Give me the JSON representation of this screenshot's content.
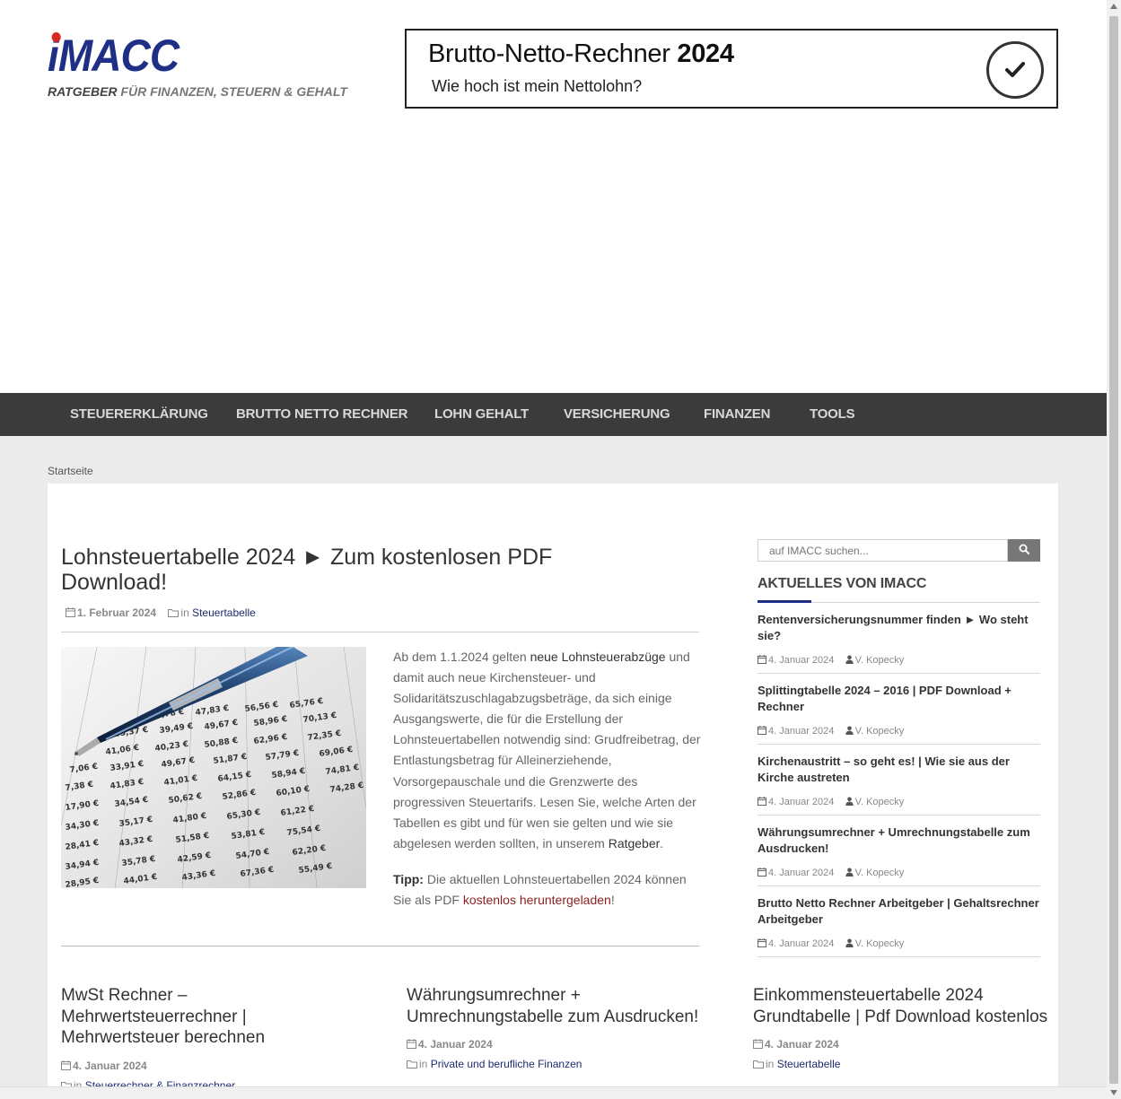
{
  "logo": {
    "wordmark": "iMACC",
    "tagline_strong": "RATGEBER",
    "tagline_rest": " FÜR FINANZEN, STEUERN & GEHALT"
  },
  "banner": {
    "title": "Brutto-Netto-Rechner",
    "year": "2024",
    "subtitle": "Wie hoch ist mein Nettolohn?"
  },
  "nav": {
    "items": [
      "STEUERERKLÄRUNG",
      "BRUTTO NETTO RECHNER",
      "LOHN GEHALT",
      "VERSICHERUNG",
      "FINANZEN",
      "TOOLS"
    ]
  },
  "breadcrumb": "Startseite",
  "post": {
    "title": "Lohnsteuertabelle 2024 ► Zum kostenlosen PDF Download!",
    "date": "1. Februar 2024",
    "in_label": "in",
    "category": "Steuertabelle",
    "excerpt_1": "Ab dem 1.1.2024 gelten ",
    "excerpt_bold_1": "neue Lohnsteuerabzüge",
    "excerpt_2": " und damit auch neue Kirchensteuer- und Solidaritätszuschlagabzugsbeträge, da sich einige Ausgangswerte, die für die Erstellung der Lohnsteuertabellen notwendig sind: Grudfreibetrag, der Entlastungsbetrag für Alleinerziehende, Vorsorgepauschale und die Grenzwerte des progressiven Steuertarifs. Lesen Sie, welche Arten der Tabellen es gibt und für wen sie gelten und wie sie abgelesen werden sollten, in unserem ",
    "excerpt_bold_2": "Ratgeber",
    "excerpt_3": ".",
    "tip_label": "Tipp:",
    "tip_text": " Die aktuellen Lohnsteuertabellen 2024 können Sie als PDF ",
    "tip_link": "kostenlos heruntergeladen",
    "tip_end": "!"
  },
  "cards": [
    {
      "title": "MwSt Rechner – Mehrwertsteuerrechner | Mehrwertsteuer berechnen",
      "date": "4. Januar 2024",
      "in_label": "in",
      "category": "Steuerrechner & Finanzrechner"
    },
    {
      "title": "Währungsumrechner + Umrechnungstabelle zum Ausdrucken!",
      "date": "4. Januar 2024",
      "in_label": "in",
      "category": "Private und berufliche Finanzen"
    },
    {
      "title": "Einkommensteuertabelle 2024 Grundtabelle | Pdf Download kostenlos",
      "date": "4. Januar 2024",
      "in_label": "in",
      "category": "Steuertabelle"
    }
  ],
  "sidebar": {
    "search_placeholder": "auf IMACC suchen...",
    "heading": "AKTUELLES VON IMACC",
    "items": [
      {
        "title": "Rentenversicherungsnummer finden ► Wo steht sie?",
        "date": "4. Januar 2024",
        "author": "V. Kopecky"
      },
      {
        "title": "Splittingtabelle 2024 – 2016 | PDF Download + Rechner",
        "date": "4. Januar 2024",
        "author": "V. Kopecky"
      },
      {
        "title": "Kirchenaustritt – so geht es! | Wie sie aus der Kirche austreten",
        "date": "4. Januar 2024",
        "author": "V. Kopecky"
      },
      {
        "title": "Währungsumrechner + Umrechnungstabelle zum Ausdrucken!",
        "date": "4. Januar 2024",
        "author": "V. Kopecky"
      },
      {
        "title": "Brutto Netto Rechner Arbeitgeber | Gehaltsrechner Arbeitgeber",
        "date": "4. Januar 2024",
        "author": "V. Kopecky"
      }
    ]
  }
}
